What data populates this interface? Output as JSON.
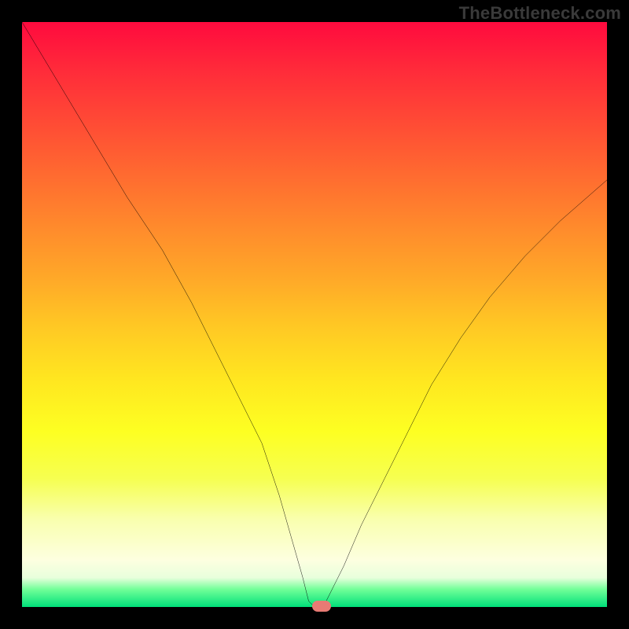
{
  "watermark": "TheBottleneck.com",
  "chart_data": {
    "type": "line",
    "title": "",
    "xlabel": "",
    "ylabel": "",
    "xlim": [
      0,
      100
    ],
    "ylim": [
      0,
      100
    ],
    "grid": false,
    "curve": {
      "x": [
        0,
        6,
        12,
        18,
        24,
        29,
        33,
        37,
        41,
        44,
        46,
        48,
        49,
        50,
        51,
        52,
        55,
        58,
        62,
        66,
        70,
        75,
        80,
        86,
        92,
        100
      ],
      "y": [
        100,
        90,
        80,
        70,
        61,
        52,
        44,
        36,
        28,
        19,
        12,
        5,
        1,
        0,
        0,
        1,
        7,
        14,
        22,
        30,
        38,
        46,
        53,
        60,
        66,
        73
      ]
    },
    "minimum_marker": {
      "x": 51.2,
      "y": 0.2
    },
    "background_gradient_stops": [
      {
        "pos": 0.0,
        "color": "#ff0a3e"
      },
      {
        "pos": 0.7,
        "color": "#fdff22"
      },
      {
        "pos": 0.97,
        "color": "#71ff98"
      },
      {
        "pos": 1.0,
        "color": "#00e07a"
      }
    ]
  }
}
